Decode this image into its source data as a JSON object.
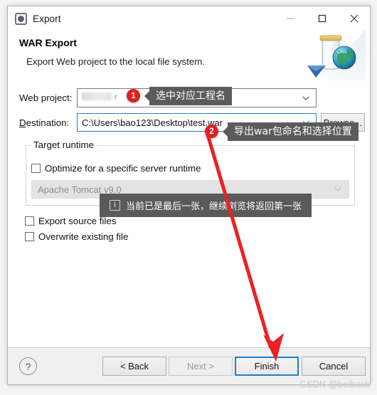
{
  "window": {
    "title": "Export",
    "icon": "export-wizard-icon",
    "controls": {
      "minimize": "–",
      "maximize": "□",
      "close": "✕"
    }
  },
  "header": {
    "title": "WAR Export",
    "subtitle": "Export Web project to the local file system.",
    "art": "war-jar-globe-icon"
  },
  "form": {
    "web_project_label": "Web project:",
    "web_project_value": "",
    "destination_label": "Destination:",
    "destination_value": "C:\\Users\\bao123\\Desktop\\test.war",
    "browse_label": "Browse...",
    "target_runtime_group": "Target runtime",
    "optimize_label": "Optimize for a specific server runtime",
    "optimize_checked": false,
    "runtime_value": "Apache Tomcat v9.0",
    "runtime_disabled": true,
    "export_source_label": "Export source files",
    "export_source_checked": false,
    "overwrite_label": "Overwrite existing file",
    "overwrite_checked": false
  },
  "footer": {
    "help": "?",
    "back_label": "< Back",
    "next_label": "Next >",
    "finish_label": "Finish",
    "cancel_label": "Cancel",
    "next_disabled": true,
    "finish_is_default": true
  },
  "annotations": {
    "badge1": "1",
    "tip1": "选中对应工程名",
    "badge2": "2",
    "tip2": "导出war包命名和选择位置",
    "info_tip": "当前已是最后一张，继续浏览将返回第一张",
    "info_icon": "i",
    "arrow_color": "#ec2024",
    "badge_color": "#e02020",
    "tip_bg": "#5b5b5b"
  },
  "watermark": "CSDN @beiback"
}
